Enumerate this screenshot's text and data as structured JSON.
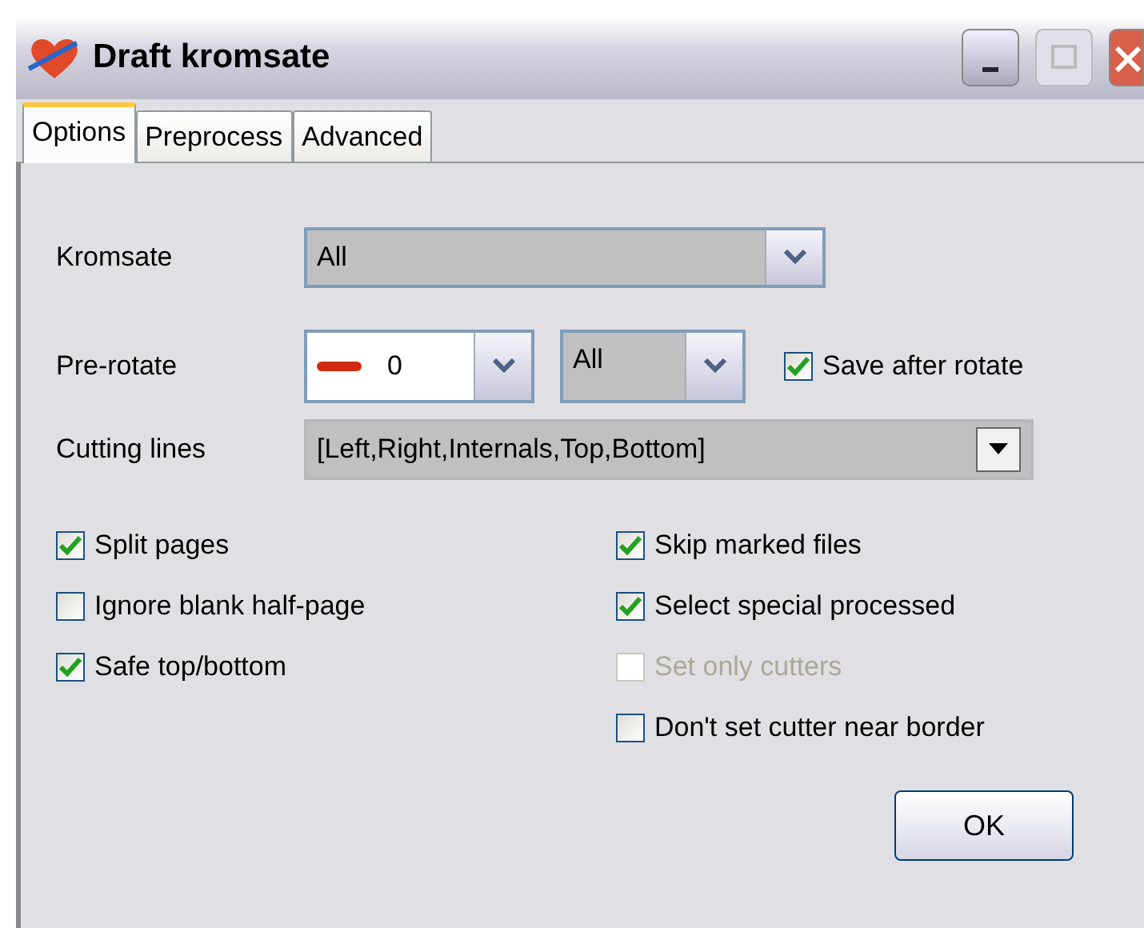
{
  "window": {
    "title": "Draft kromsate"
  },
  "tabs": [
    {
      "label": "Options",
      "selected": true
    },
    {
      "label": "Preprocess",
      "selected": false
    },
    {
      "label": "Advanced",
      "selected": false
    }
  ],
  "kromsate": {
    "label": "Kromsate",
    "value": "All"
  },
  "pre_rotate": {
    "label": "Pre-rotate",
    "angle": "0",
    "pages": "All",
    "save_after_rotate": {
      "label": "Save after rotate",
      "checked": true
    }
  },
  "cutting_lines": {
    "label": "Cutting lines",
    "value": "[Left,Right,Internals,Top,Bottom]"
  },
  "left_options": [
    {
      "label": "Split pages",
      "checked": true,
      "disabled": false
    },
    {
      "label": "Ignore blank half-page",
      "checked": false,
      "disabled": false
    },
    {
      "label": "Safe top/bottom",
      "checked": true,
      "disabled": false
    }
  ],
  "right_options": [
    {
      "label": "Skip marked files",
      "checked": true,
      "disabled": false
    },
    {
      "label": "Select special processed",
      "checked": true,
      "disabled": false
    },
    {
      "label": "Set only cutters",
      "checked": false,
      "disabled": true
    },
    {
      "label": "Don't set cutter near border",
      "checked": false,
      "disabled": false
    }
  ],
  "ok_button": "OK"
}
